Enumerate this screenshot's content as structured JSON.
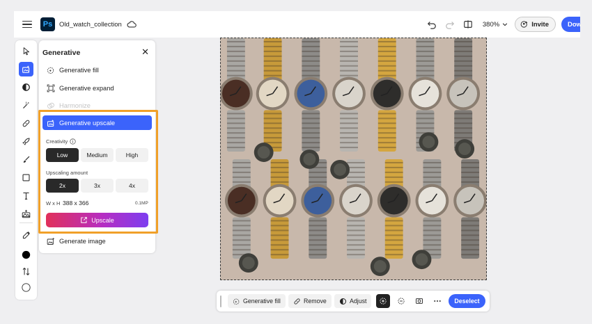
{
  "app": {
    "document_title": "Old_watch_collection",
    "zoom": "380%",
    "invite_label": "Invite",
    "download_label": "Download",
    "accent_color": "#3b63fb",
    "highlight_color": "#f0a029"
  },
  "tools": [
    {
      "name": "select-tool",
      "icon": "arrow-pointer-icon"
    },
    {
      "name": "generative-tool",
      "icon": "generative-sparkle-icon",
      "active": true
    },
    {
      "name": "adjust-tool",
      "icon": "half-circle-icon"
    },
    {
      "name": "quick-select-tool",
      "icon": "magic-select-icon"
    },
    {
      "name": "heal-tool",
      "icon": "bandage-icon"
    },
    {
      "name": "quick-actions-tool",
      "icon": "rocket-icon"
    },
    {
      "name": "brush-tool",
      "icon": "brush-icon"
    },
    {
      "name": "shape-tool",
      "icon": "square-icon"
    },
    {
      "name": "text-tool",
      "icon": "text-icon"
    },
    {
      "name": "add-image-tool",
      "icon": "image-add-icon"
    },
    {
      "name": "eyedropper-tool",
      "icon": "eyedropper-icon"
    }
  ],
  "panel": {
    "title": "Generative",
    "items": {
      "fill": "Generative fill",
      "expand": "Generative expand",
      "harmonize": "Harmonize",
      "upscale": "Generative upscale",
      "image": "Generate image"
    },
    "creativity": {
      "label": "Creativity",
      "options": [
        "Low",
        "Medium",
        "High"
      ],
      "selected": "Low"
    },
    "upscaling": {
      "label": "Upscaling amount",
      "options": [
        "2x",
        "3x",
        "4x"
      ],
      "selected": "2x"
    },
    "dimensions": {
      "label": "W x H",
      "value": "388 x 366",
      "megapixels": "0.1MP"
    },
    "upscale_button": "Upscale"
  },
  "bottombar": {
    "generative_fill": "Generative fill",
    "remove": "Remove",
    "adjust": "Adjust",
    "deselect": "Deselect"
  }
}
